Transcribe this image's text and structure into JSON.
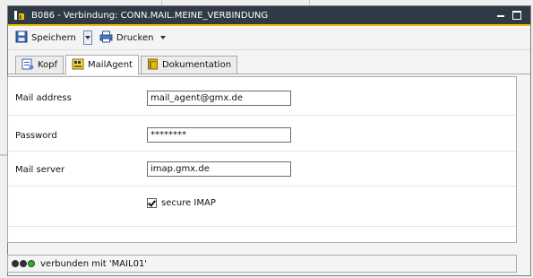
{
  "window": {
    "title": "B086 - Verbindung: CONN.MAIL.MEINE_VERBINDUNG",
    "minimize_icon": "minimize-icon",
    "maximize_icon": "maximize-icon"
  },
  "toolbar": {
    "save_label": "Speichern",
    "print_label": "Drucken",
    "save_icon": "floppy-disk-icon",
    "print_icon": "printer-icon"
  },
  "tabs": [
    {
      "label": "Kopf",
      "icon": "header-icon",
      "active": false
    },
    {
      "label": "MailAgent",
      "icon": "mail-agent-icon",
      "active": true
    },
    {
      "label": "Dokumentation",
      "icon": "book-icon",
      "active": false
    }
  ],
  "form": {
    "mail_address": {
      "label": "Mail address",
      "value": "mail_agent@gmx.de"
    },
    "password": {
      "label": "Password",
      "value": "********"
    },
    "mail_server": {
      "label": "Mail server",
      "value": "imap.gmx.de"
    },
    "secure_imap": {
      "label": "secure IMAP",
      "checked": true
    }
  },
  "status": {
    "text": "verbunden mit 'MAIL01'",
    "indicator_colors": [
      "#2f2f2f",
      "#2f2f2f",
      "#1fbf1f"
    ]
  }
}
